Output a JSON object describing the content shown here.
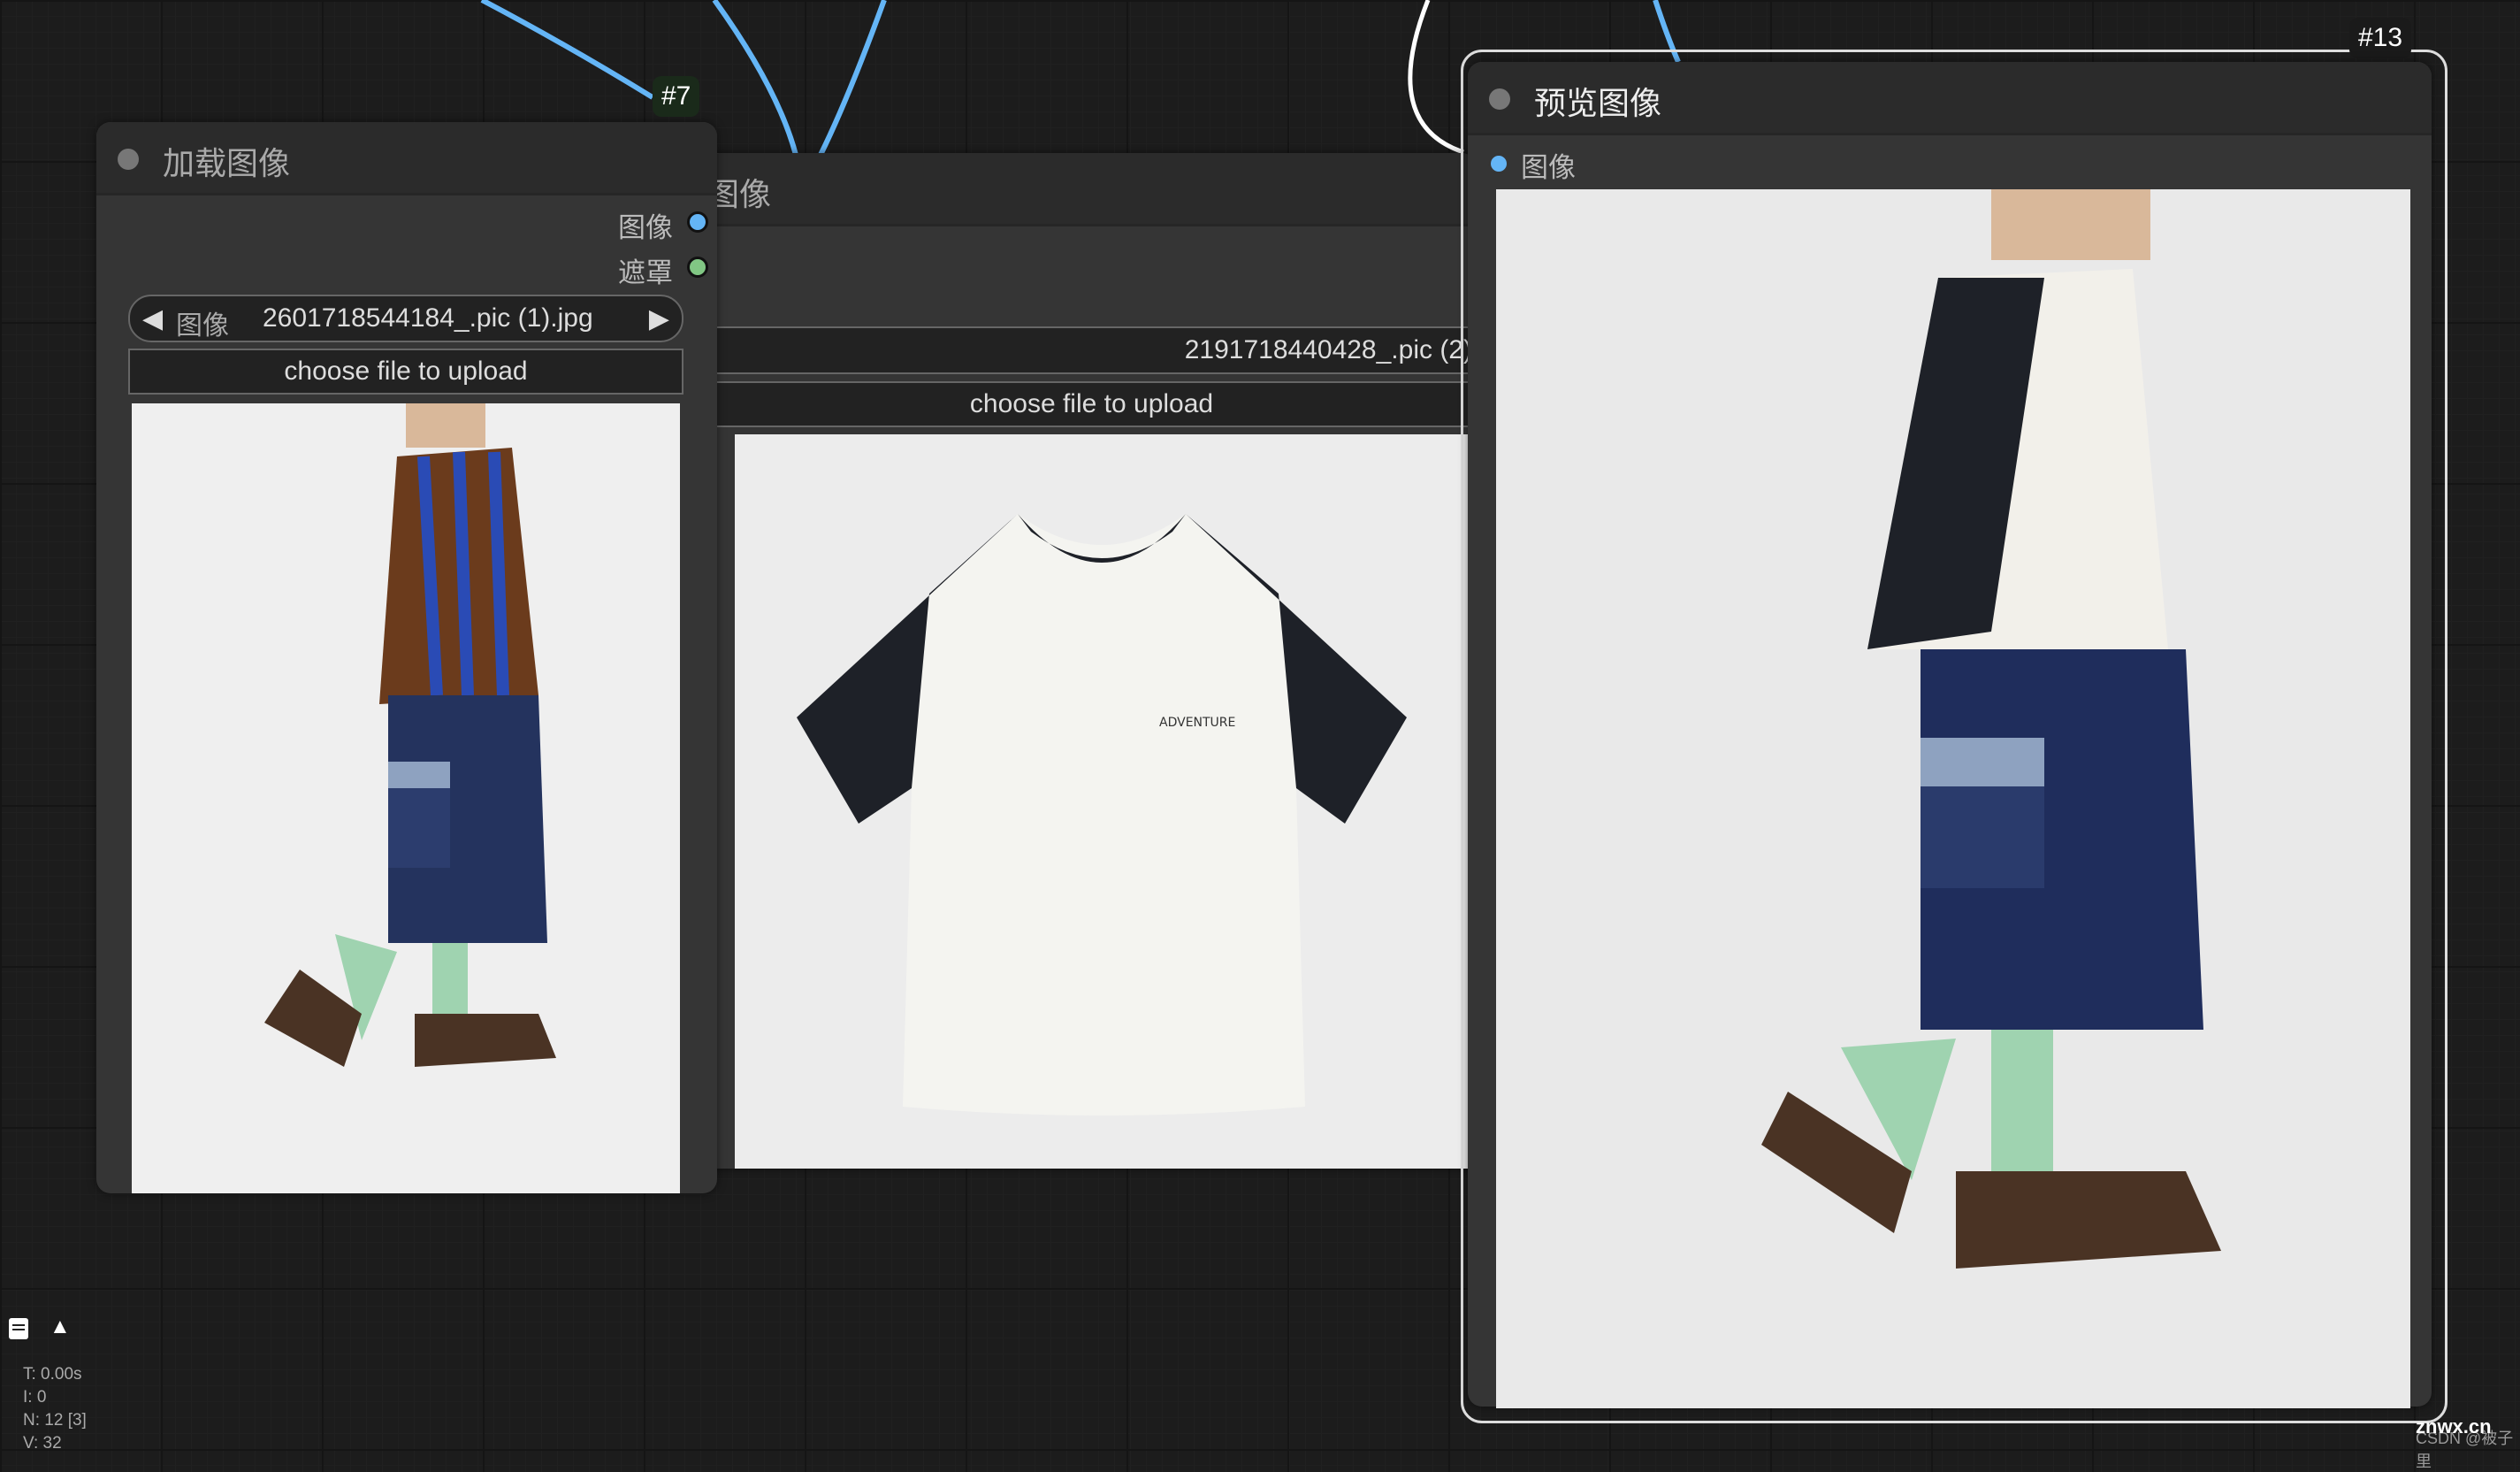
{
  "nodes": {
    "load_image_1": {
      "id": "#7",
      "title": "加载图像",
      "outputs": [
        {
          "label": "图像",
          "color": "#64b5f6"
        },
        {
          "label": "遮罩",
          "color": "#81c784"
        }
      ],
      "combo": {
        "label": "图像",
        "value": "2601718544184_.pic (1).jpg"
      },
      "upload_label": "choose file to upload"
    },
    "load_image_2": {
      "title": "图像",
      "filename": "2191718440428_.pic (2)",
      "upload_label": "choose file to upload"
    },
    "preview_image": {
      "id": "#13",
      "title": "预览图像",
      "input": {
        "label": "图像",
        "color": "#64b5f6"
      }
    }
  },
  "stats": {
    "t": "T: 0.00s",
    "i": "I: 0",
    "n": "N: 12 [3]",
    "v": "V: 32"
  },
  "toolbar_icons": [
    "queue-list-icon",
    "rocket-icon"
  ],
  "watermark": {
    "main": "znwx.cn",
    "sub": "CSDN @被子里"
  },
  "colors": {
    "link_image": "#64b5f6",
    "link_selected": "#ffffff",
    "canvas": "#1c1c1c"
  }
}
